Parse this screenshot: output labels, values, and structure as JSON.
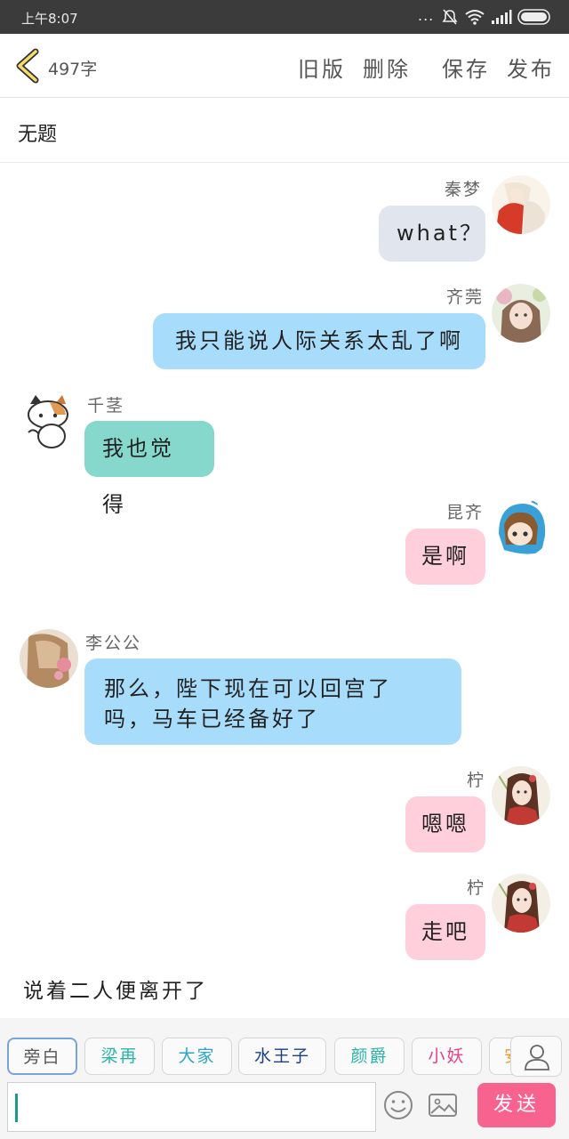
{
  "status_bar": {
    "time": "上午8:07",
    "dots": "..."
  },
  "header": {
    "word_count": "497字",
    "old_version": "旧版",
    "delete": "删除",
    "save": "保存",
    "publish": "发布"
  },
  "title": "无题",
  "messages": [
    {
      "name": "秦梦",
      "text": "what？",
      "side": "right",
      "color": "#e0e5ee"
    },
    {
      "name": "齐莞",
      "text": "我只能说人际关系太乱了啊",
      "side": "right",
      "color": "#a8dcfb"
    },
    {
      "name": "千茎",
      "text": "我也觉得",
      "side": "left",
      "color": "#86d8cd"
    },
    {
      "name": "昆齐",
      "text": "是啊",
      "side": "right",
      "color": "#ffcfdc"
    },
    {
      "name": "李公公",
      "text_line1": "那么，陛下现在可以回宫了",
      "text_line2": "吗，马车已经备好了",
      "side": "left",
      "color": "#a8dcfb"
    },
    {
      "name": "柠",
      "text": "嗯嗯",
      "side": "right",
      "color": "#ffcfdc"
    },
    {
      "name": "柠",
      "text": "走吧",
      "side": "right",
      "color": "#ffcfdc"
    }
  ],
  "narration": "说着二人便离开了",
  "roles": [
    {
      "label": "旁白",
      "color": "#555555"
    },
    {
      "label": "梁再",
      "color": "#2bb5a8"
    },
    {
      "label": "大家",
      "color": "#2aa6c8"
    },
    {
      "label": "水王子",
      "color": "#1b3f8a"
    },
    {
      "label": "颜爵",
      "color": "#2bb5a8"
    },
    {
      "label": "小妖",
      "color": "#e8408a"
    },
    {
      "label": "安",
      "color": "#f29a2e"
    }
  ],
  "input": {
    "value": "",
    "placeholder": ""
  },
  "send": "发送",
  "icons": [
    "back-chevron-icon",
    "emoji-icon",
    "image-icon",
    "person-icon",
    "wifi-icon",
    "signal-icon",
    "battery-icon",
    "mute-bell-icon"
  ]
}
